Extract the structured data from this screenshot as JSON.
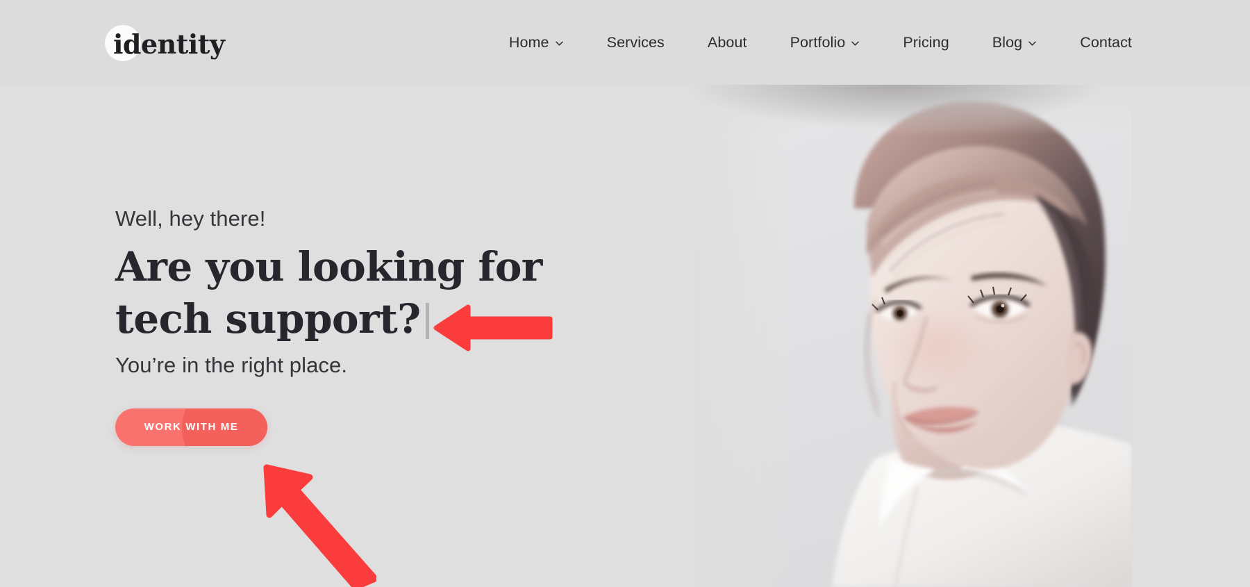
{
  "site": {
    "logo_text": "identity",
    "background_color": "#dfdfdf",
    "header_color": "#dcdcdc",
    "accent_color": "#f9726e",
    "annotation_color": "#fa3c3c",
    "heading_color": "#26262c"
  },
  "header": {
    "nav": [
      {
        "label": "Home",
        "has_dropdown": true,
        "icon": "chevron-down-icon"
      },
      {
        "label": "Services",
        "has_dropdown": false,
        "icon": ""
      },
      {
        "label": "About",
        "has_dropdown": false,
        "icon": ""
      },
      {
        "label": "Portfolio",
        "has_dropdown": true,
        "icon": "chevron-down-icon"
      },
      {
        "label": "Pricing",
        "has_dropdown": false,
        "icon": ""
      },
      {
        "label": "Blog",
        "has_dropdown": true,
        "icon": "chevron-down-icon"
      },
      {
        "label": "Contact",
        "has_dropdown": false,
        "icon": ""
      }
    ]
  },
  "hero": {
    "eyebrow": "Well, hey there!",
    "headline_line1": "Are you looking for",
    "headline_line2": "tech support?",
    "subline": "You’re in the right place.",
    "cta_label": "WORK WITH ME",
    "photo_alt": "portrait-photo-woman-smiling"
  },
  "annotations": [
    {
      "name": "arrow-pointing-to-headline",
      "direction": "left",
      "color": "#fa3c3c"
    },
    {
      "name": "arrow-pointing-to-cta",
      "direction": "up-left",
      "color": "#fa3c3c"
    }
  ]
}
